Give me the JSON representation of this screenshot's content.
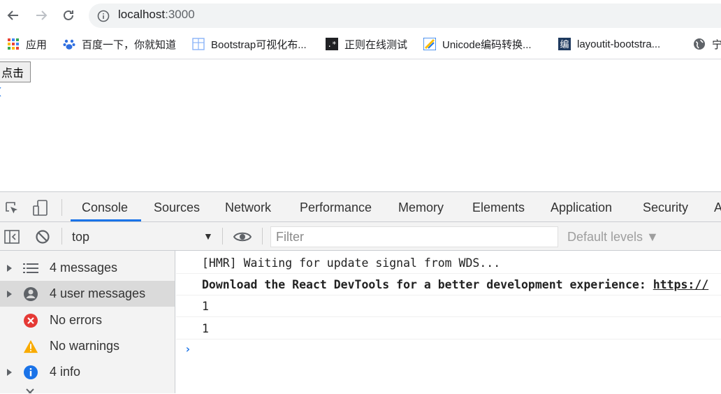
{
  "browser": {
    "url_host": "localhost",
    "url_port": ":3000"
  },
  "bookmarks": [
    {
      "label": "应用",
      "icon": "apps-grid-icon"
    },
    {
      "label": "百度一下，你就知道",
      "icon": "baidu-paw-icon"
    },
    {
      "label": "Bootstrap可视化布...",
      "icon": "layout-grid-icon"
    },
    {
      "label": "正则在线测试",
      "icon": "regex-icon"
    },
    {
      "label": "Unicode编码转换...",
      "icon": "unicode-icon"
    },
    {
      "label": "layoutit-bootstra...",
      "icon": "bian-icon"
    },
    {
      "label": "宁",
      "icon": "globe-icon"
    }
  ],
  "page": {
    "button_label": "点击",
    "under_text": "("
  },
  "devtools": {
    "tabs": [
      "Console",
      "Sources",
      "Network",
      "Performance",
      "Memory",
      "Elements",
      "Application",
      "Security",
      "A"
    ],
    "active_tab": "Console",
    "context": "top",
    "filter_placeholder": "Filter",
    "levels": "Default levels ▼",
    "accent": "#1a73e8"
  },
  "sidebar": [
    {
      "label": "4 messages",
      "icon": "list-icon",
      "expandable": true,
      "selected": false
    },
    {
      "label": "4 user messages",
      "icon": "user-icon",
      "expandable": true,
      "selected": true
    },
    {
      "label": "No errors",
      "icon": "error-icon",
      "expandable": false,
      "selected": false
    },
    {
      "label": "No warnings",
      "icon": "warning-icon",
      "expandable": false,
      "selected": false
    },
    {
      "label": "4 info",
      "icon": "info-icon",
      "expandable": true,
      "selected": false
    }
  ],
  "console": {
    "messages": [
      {
        "text": "[HMR] Waiting for update signal from WDS...",
        "bold": false
      },
      {
        "text": "Download the React DevTools for a better development experience: ",
        "link": "https://",
        "bold": true
      },
      {
        "text": "1",
        "bold": false
      },
      {
        "text": "1",
        "bold": false
      }
    ],
    "prompt": "›"
  }
}
